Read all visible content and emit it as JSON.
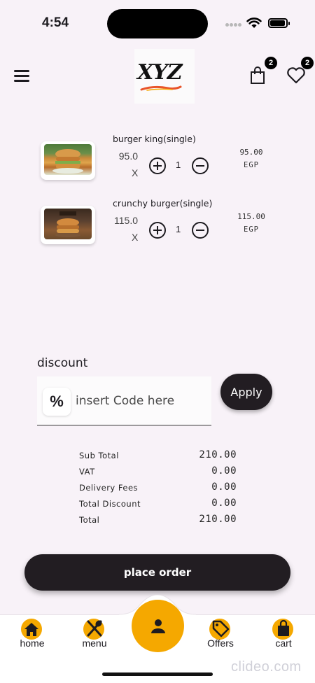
{
  "status_bar": {
    "time": "4:54"
  },
  "header": {
    "logo_text": "XYZ",
    "cart_badge": "2",
    "favorites_badge": "2"
  },
  "cart_items": [
    {
      "name": "burger king(single)",
      "unit_price": "95.0",
      "multiplier": "X",
      "quantity": "1",
      "line_total": "95.00",
      "currency": "EGP"
    },
    {
      "name": "crunchy burger(single)",
      "unit_price": "115.0",
      "multiplier": "X",
      "quantity": "1",
      "line_total": "115.00",
      "currency": "EGP"
    }
  ],
  "discount": {
    "label": "discount",
    "icon": "%",
    "placeholder": "insert Code here",
    "value": "",
    "apply_label": "Apply"
  },
  "summary": [
    {
      "label": "Sub Total",
      "value": "210.00"
    },
    {
      "label": "VAT",
      "value": "0.00"
    },
    {
      "label": "Delivery Fees",
      "value": "0.00"
    },
    {
      "label": "Total Discount",
      "value": "0.00"
    },
    {
      "label": "Total",
      "value": "210.00"
    }
  ],
  "place_order_label": "place order",
  "bottom_nav": {
    "items": [
      {
        "label": "home",
        "icon": "home-icon"
      },
      {
        "label": "menu",
        "icon": "fork-spoon-icon"
      },
      {
        "label": "Offers",
        "icon": "tag-icon"
      },
      {
        "label": "cart",
        "icon": "shopping-bag-icon"
      }
    ],
    "fab_icon": "person-icon"
  },
  "watermark": "clideo.com",
  "colors": {
    "accent": "#f5a800",
    "dark": "#221d22",
    "background": "#f8f2f8"
  }
}
